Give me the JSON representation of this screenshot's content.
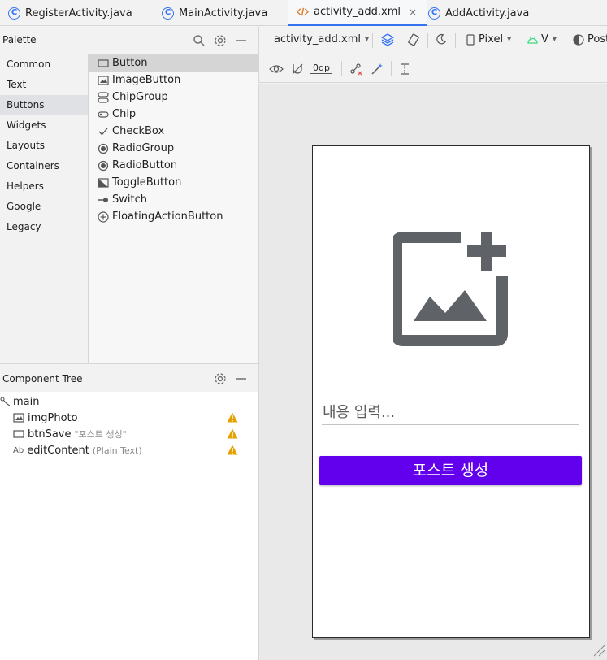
{
  "tabs": [
    {
      "label": "RegisterActivity.java",
      "icon": "class-icon"
    },
    {
      "label": "MainActivity.java",
      "icon": "class-icon"
    },
    {
      "label": "activity_add.xml",
      "icon": "xml-icon",
      "active": true,
      "close": "×"
    },
    {
      "label": "AddActivity.java",
      "icon": "class-icon"
    }
  ],
  "palette": {
    "title": "Palette",
    "categories": [
      "Common",
      "Text",
      "Buttons",
      "Widgets",
      "Layouts",
      "Containers",
      "Helpers",
      "Google",
      "Legacy"
    ],
    "selected_category": "Buttons",
    "items": [
      "Button",
      "ImageButton",
      "ChipGroup",
      "Chip",
      "CheckBox",
      "RadioGroup",
      "RadioButton",
      "ToggleButton",
      "Switch",
      "FloatingActionButton"
    ],
    "selected_item": "Button"
  },
  "component_tree": {
    "title": "Component Tree",
    "root": "main",
    "nodes": [
      {
        "name": "imgPhoto",
        "sub": ""
      },
      {
        "name": "btnSave",
        "sub": "\"포스트 생성\""
      },
      {
        "name": "editContent",
        "sub": "(Plain Text)"
      }
    ],
    "ab_label": "Ab"
  },
  "design_toolbar": {
    "file": "activity_add.xml",
    "device": "Pixel",
    "api": "V",
    "theme": "Post",
    "margin": "0dp"
  },
  "preview": {
    "edit_hint": "내용 입력...",
    "button_label": "포스트 생성",
    "button_color": "#6200ee"
  },
  "colors": {
    "accent": "#3574f0",
    "warning": "#e5a100"
  }
}
